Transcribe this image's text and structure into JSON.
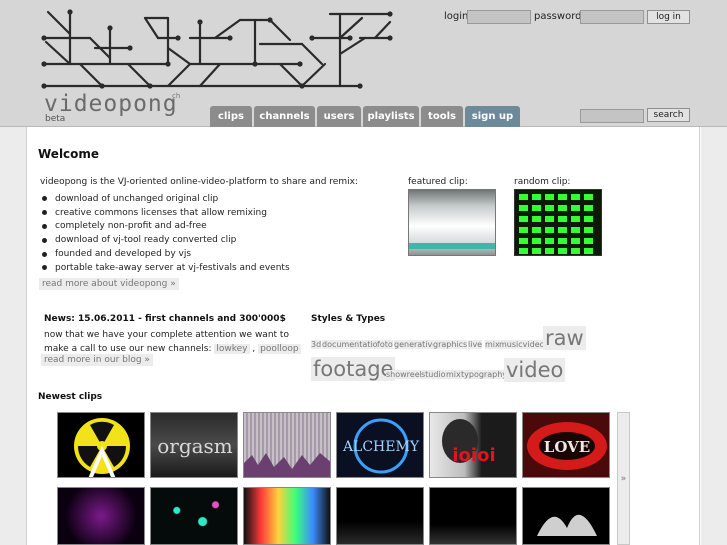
{
  "brand": {
    "name": "videopong",
    "sup": "ch",
    "beta": "beta"
  },
  "login": {
    "login_label": "login:",
    "password_label": "password:",
    "button": "log in"
  },
  "nav": {
    "tabs": [
      "clips",
      "channels",
      "users",
      "playlists",
      "tools",
      "sign up"
    ]
  },
  "search": {
    "button": "search"
  },
  "welcome": {
    "title": "Welcome",
    "intro": "videopong is the VJ-oriented online-video-platform to share and remix:",
    "bullets": [
      "download of unchanged original clip",
      "creative commons licenses that allow remixing",
      "completely non-profit and ad-free",
      "download of vj-tool ready converted clip",
      "founded and developed by vjs",
      "portable take-away server at vj-festivals and events"
    ],
    "read_more": "read more about videopong »"
  },
  "featured": {
    "label": "featured clip:"
  },
  "random": {
    "label": "random clip:"
  },
  "news": {
    "title": "News: 15.06.2011 - first channels and 300'000$",
    "text_1": "now that we have your complete attention we want to make a call to use our new channels: ",
    "tag_1": "lowkey",
    "sep": " , ",
    "tag_2": "poolloop",
    "end": " .",
    "read_more": "read more in our blog »"
  },
  "styles": {
    "title": "Styles & Types",
    "tags": [
      "3d",
      "documentation",
      "foto",
      "generative",
      "graphics",
      "live",
      "mix",
      "musicvideo",
      "raw",
      "footage",
      "showreel",
      "studio",
      "mix",
      "typography",
      "video"
    ]
  },
  "newest": {
    "title": "Newest clips",
    "more": "»"
  },
  "colors": {
    "header_bg": "#d6d6d6",
    "tab_bg": "#8c8c8c",
    "signup_tab_bg": "#6d8a9b",
    "tag_bg": "#ececec"
  }
}
